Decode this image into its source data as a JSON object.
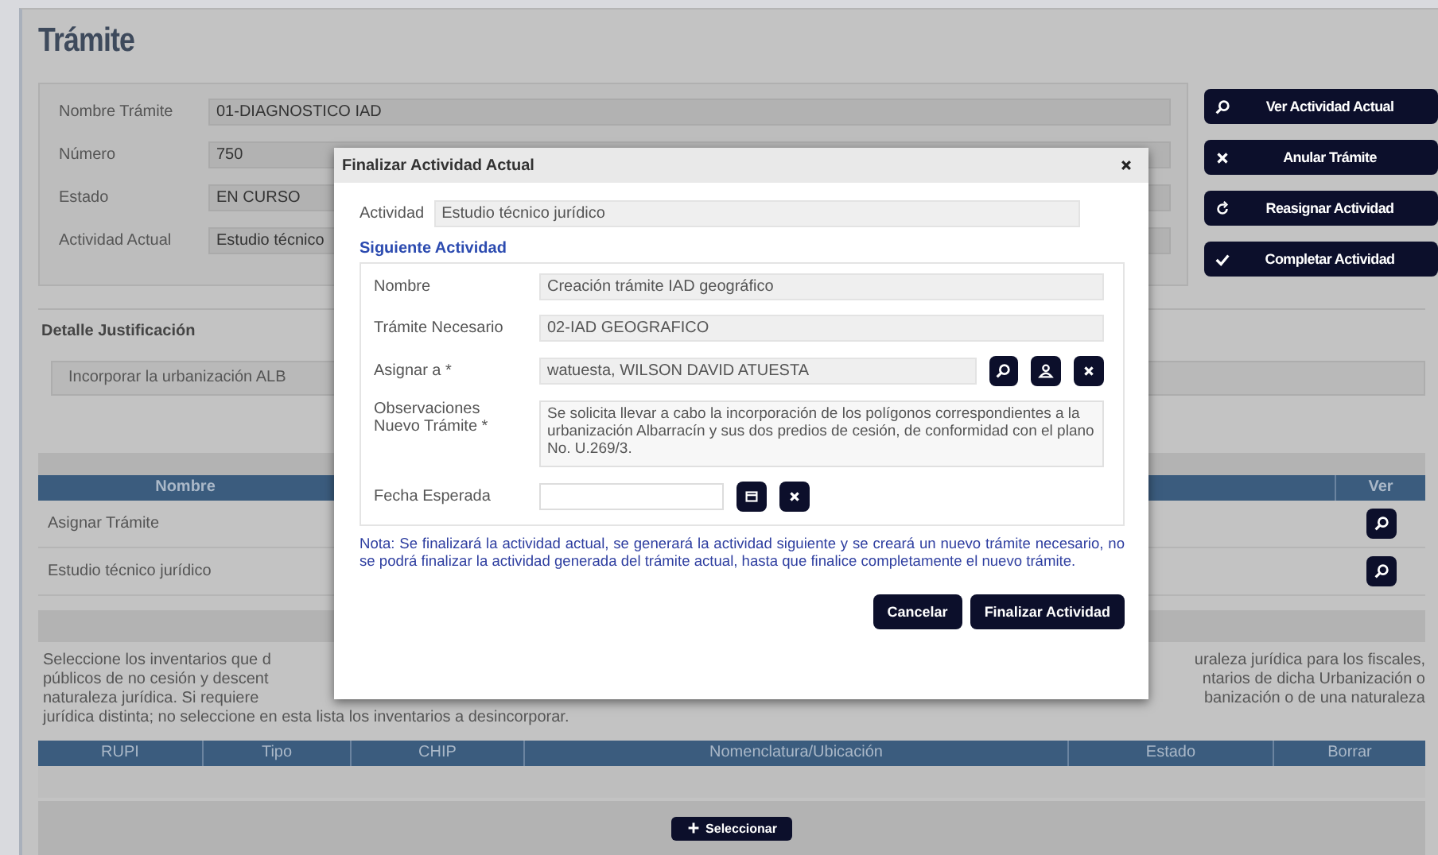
{
  "page": {
    "title": "Trámite"
  },
  "info_fields": [
    {
      "label": "Nombre Trámite",
      "value": "01-DIAGNOSTICO IAD"
    },
    {
      "label": "Número",
      "value": "750"
    },
    {
      "label": "Estado",
      "value": "EN CURSO"
    },
    {
      "label": "Actividad Actual",
      "value": "Estudio técnico"
    }
  ],
  "action_buttons": [
    {
      "label": "Ver Actividad Actual"
    },
    {
      "label": "Anular Trámite"
    },
    {
      "label": "Reasignar Actividad"
    },
    {
      "label": "Completar Actividad"
    }
  ],
  "detail": {
    "label": "Detalle Justificación",
    "value": "Incorporar la urbanización ALB"
  },
  "activities_table": {
    "columns": [
      "Nombre",
      "Ver"
    ],
    "rows": [
      {
        "name": "Asignar Trámite"
      },
      {
        "name": "Estudio técnico jurídico"
      }
    ]
  },
  "inventory_text": {
    "left_lines": [
      "Seleccione los inventarios que d",
      "públicos de no cesión y descent",
      "naturaleza jurídica. Si requiere"
    ],
    "right_lines": [
      "uraleza jurídica para los fiscales,",
      "ntarios de dicha Urbanización o",
      "banización o de una naturaleza"
    ],
    "last_line": "jurídica distinta; no seleccione en esta lista los inventarios a desincorporar."
  },
  "inventory_table": {
    "columns": [
      "RUPI",
      "Tipo",
      "CHIP",
      "Nomenclatura/Ubicación",
      "Estado",
      "Borrar"
    ]
  },
  "select_button": {
    "label": "Seleccionar"
  },
  "modal": {
    "title": "Finalizar Actividad Actual",
    "activity": {
      "label": "Actividad",
      "value": "Estudio técnico jurídico"
    },
    "section_title": "Siguiente Actividad",
    "fields": [
      {
        "kind": "text",
        "label": "Nombre",
        "value": "Creación trámite IAD geográfico"
      },
      {
        "kind": "text",
        "label": "Trámite Necesario",
        "value": "02-IAD GEOGRAFICO"
      },
      {
        "kind": "lookup",
        "label": "Asignar a *",
        "value": "watuesta, WILSON DAVID ATUESTA"
      },
      {
        "kind": "textarea",
        "label": "Observaciones Nuevo Trámite *",
        "value": "Se solicita llevar a cabo la incorporación de los polígonos correspondientes a la urbanización Albarracín y sus dos predios de cesión, de conformidad con el plano No. U.269/3."
      },
      {
        "kind": "date",
        "label": "Fecha Esperada"
      }
    ],
    "note": "Nota: Se finalizará la actividad actual, se generará la actividad siguiente y se creará un nuevo trámite necesario, no se podrá finalizar la actividad generada del trámite actual, hasta que finalice completamente el nuevo trámite.",
    "buttons": [
      "Cancelar",
      "Finalizar Actividad"
    ]
  }
}
